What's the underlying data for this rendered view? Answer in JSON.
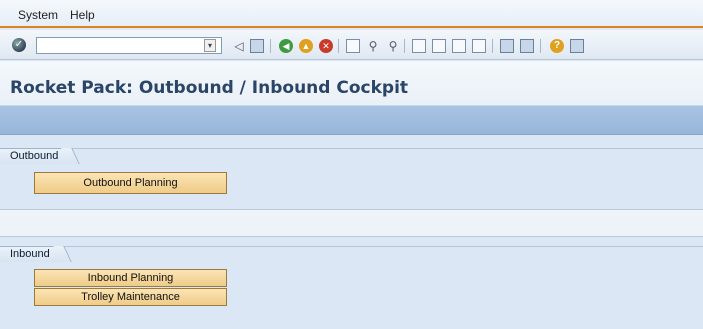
{
  "menu": {
    "items": [
      {
        "label": "System"
      },
      {
        "label": "Help"
      }
    ]
  },
  "toolbar": {
    "command_field_value": "",
    "icons": [
      "enter-icon",
      "dropdown-icon",
      "back-arrow-icon",
      "save-icon",
      "back-icon",
      "exit-icon",
      "cancel-icon",
      "print-icon",
      "find-icon",
      "find-next-icon",
      "first-page-icon",
      "previous-page-icon",
      "next-page-icon",
      "last-page-icon",
      "create-session-icon",
      "shortcut-icon",
      "help-icon",
      "customize-layout-icon"
    ]
  },
  "header": {
    "title": "Rocket Pack: Outbound / Inbound Cockpit"
  },
  "groups": {
    "outbound": {
      "label": "Outbound",
      "buttons": [
        {
          "label": "Outbound Planning"
        }
      ]
    },
    "inbound": {
      "label": "Inbound",
      "buttons": [
        {
          "label": "Inbound Planning"
        },
        {
          "label": "Trolley Maintenance"
        }
      ]
    }
  },
  "colors": {
    "title_text": "#2a4568",
    "menu_underline": "#e0821d",
    "app_toolbar": "#a9c3e2",
    "button_fill": "#efcc88",
    "button_border": "#9c7a3b"
  }
}
